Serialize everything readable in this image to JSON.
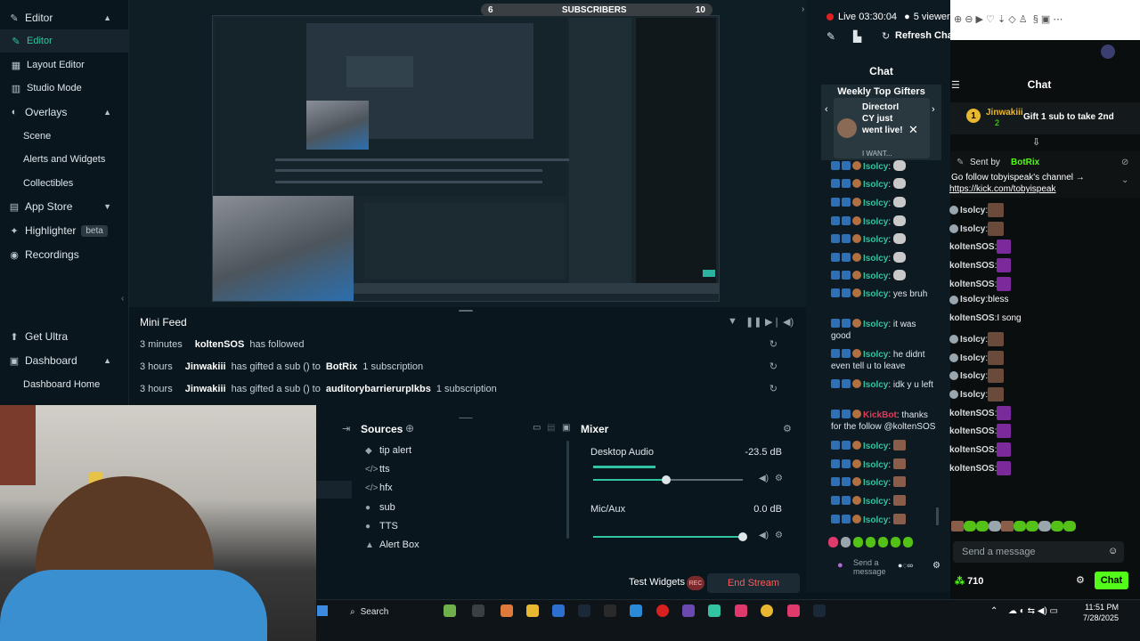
{
  "sidebar": {
    "editor_group": "Editor",
    "items": [
      {
        "label": "Editor",
        "icon": "pencil-icon"
      },
      {
        "label": "Layout Editor",
        "icon": "layout-icon"
      },
      {
        "label": "Studio Mode",
        "icon": "studio-icon"
      }
    ],
    "overlays_group": "Overlays",
    "overlay_items": [
      "Scene",
      "Alerts and Widgets",
      "Collectibles"
    ],
    "app_store": "App Store",
    "highlighter": "Highlighter",
    "highlighter_badge": "beta",
    "recordings": "Recordings",
    "get_ultra": "Get Ultra",
    "dashboard": "Dashboard",
    "dashboard_home": "Dashboard Home"
  },
  "preview": {
    "sub_goal_left": "6",
    "sub_goal_label": "SUBSCRIBERS",
    "sub_goal_right": "10"
  },
  "minifeed": {
    "title": "Mini Feed",
    "rows": [
      {
        "time": "3 minutes",
        "who": "koltenSOS",
        "action": "has followed",
        "target": "",
        "detail": ""
      },
      {
        "time": "3 hours",
        "who": "Jinwakiii",
        "action": "has gifted a sub () to",
        "target": "BotRix",
        "detail": "1 subscription"
      },
      {
        "time": "3 hours",
        "who": "Jinwakiii",
        "action": "has gifted a sub () to",
        "target": "auditorybarrierurplkbs",
        "detail": "1 subscription"
      }
    ]
  },
  "sources": {
    "title": "Sources",
    "items": [
      "tip alert",
      "tts",
      "hfx",
      "sub",
      "TTS",
      "Alert Box"
    ]
  },
  "mixer": {
    "title": "Mixer",
    "channels": [
      {
        "name": "Desktop Audio",
        "db": "-23.5 dB",
        "level": 0.49
      },
      {
        "name": "Mic/Aux",
        "db": "0.0 dB",
        "level": 1.0
      }
    ]
  },
  "actions": {
    "test_widgets": "Test Widgets",
    "end_stream": "End Stream",
    "rec": "REC"
  },
  "stream_status": {
    "live": "Live 03:30:04",
    "viewers": "5 viewers",
    "refresh_chat": "Refresh Chat"
  },
  "chat1": {
    "title": "Chat",
    "gifters_title": "Weekly Top Gifters",
    "popup": "DirectorI CY just went live!",
    "popup_sub": "I WANT...",
    "messages": [
      {
        "name": "Isolcy",
        "text": ""
      },
      {
        "name": "Isolcy",
        "text": ""
      },
      {
        "name": "Isolcy",
        "text": ""
      },
      {
        "name": "Isolcy",
        "text": ""
      },
      {
        "name": "Isolcy",
        "text": ""
      },
      {
        "name": "Isolcy",
        "text": ""
      },
      {
        "name": "Isolcy",
        "text": ""
      },
      {
        "name": "Isolcy",
        "text": "yes bruh"
      },
      {
        "name": "Isolcy",
        "text": "it was good"
      },
      {
        "name": "Isolcy",
        "text": "he didnt even tell u to leave"
      },
      {
        "name": "Isolcy",
        "text": "idk y u left"
      },
      {
        "name": "KickBot",
        "text": "thanks for the follow @koltenSOS"
      },
      {
        "name": "Isolcy",
        "text": ""
      },
      {
        "name": "Isolcy",
        "text": ""
      },
      {
        "name": "Isolcy",
        "text": ""
      },
      {
        "name": "Isolcy",
        "text": ""
      },
      {
        "name": "Isolcy",
        "text": ""
      }
    ],
    "input_placeholder": "Send a message"
  },
  "chat2": {
    "title": "Chat",
    "pinned_user": "Jinwakiii",
    "pinned_count": "2",
    "pinned_text": "Gift 1 sub to take 2nd",
    "sent_by_label": "Sent by",
    "sent_by_user": "BotRix",
    "announcement": "Go follow tobyispeak's channel →",
    "link": "https://kick.com/tobyispeak",
    "messages": [
      {
        "name": "Isolcy",
        "text": ""
      },
      {
        "name": "Isolcy",
        "text": ""
      },
      {
        "name": "koltenSOS",
        "text": ""
      },
      {
        "name": "koltenSOS",
        "text": ""
      },
      {
        "name": "koltenSOS",
        "text": ""
      },
      {
        "name": "Isolcy",
        "text": "bless"
      },
      {
        "name": "koltenSOS",
        "text": "I song"
      },
      {
        "name": "Isolcy",
        "text": ""
      },
      {
        "name": "Isolcy",
        "text": ""
      },
      {
        "name": "Isolcy",
        "text": ""
      },
      {
        "name": "Isolcy",
        "text": ""
      },
      {
        "name": "koltenSOS",
        "text": ""
      },
      {
        "name": "koltenSOS",
        "text": ""
      },
      {
        "name": "koltenSOS",
        "text": ""
      },
      {
        "name": "koltenSOS",
        "text": ""
      }
    ],
    "input_placeholder": "Send a message",
    "points": "710",
    "chat_button": "Chat"
  },
  "taskbar": {
    "search": "Search",
    "time": "11:51 PM",
    "date": "7/28/2025"
  },
  "colors": {
    "accent": "#31c3a2",
    "kick_green": "#53fc18",
    "live_red": "#e02020"
  }
}
